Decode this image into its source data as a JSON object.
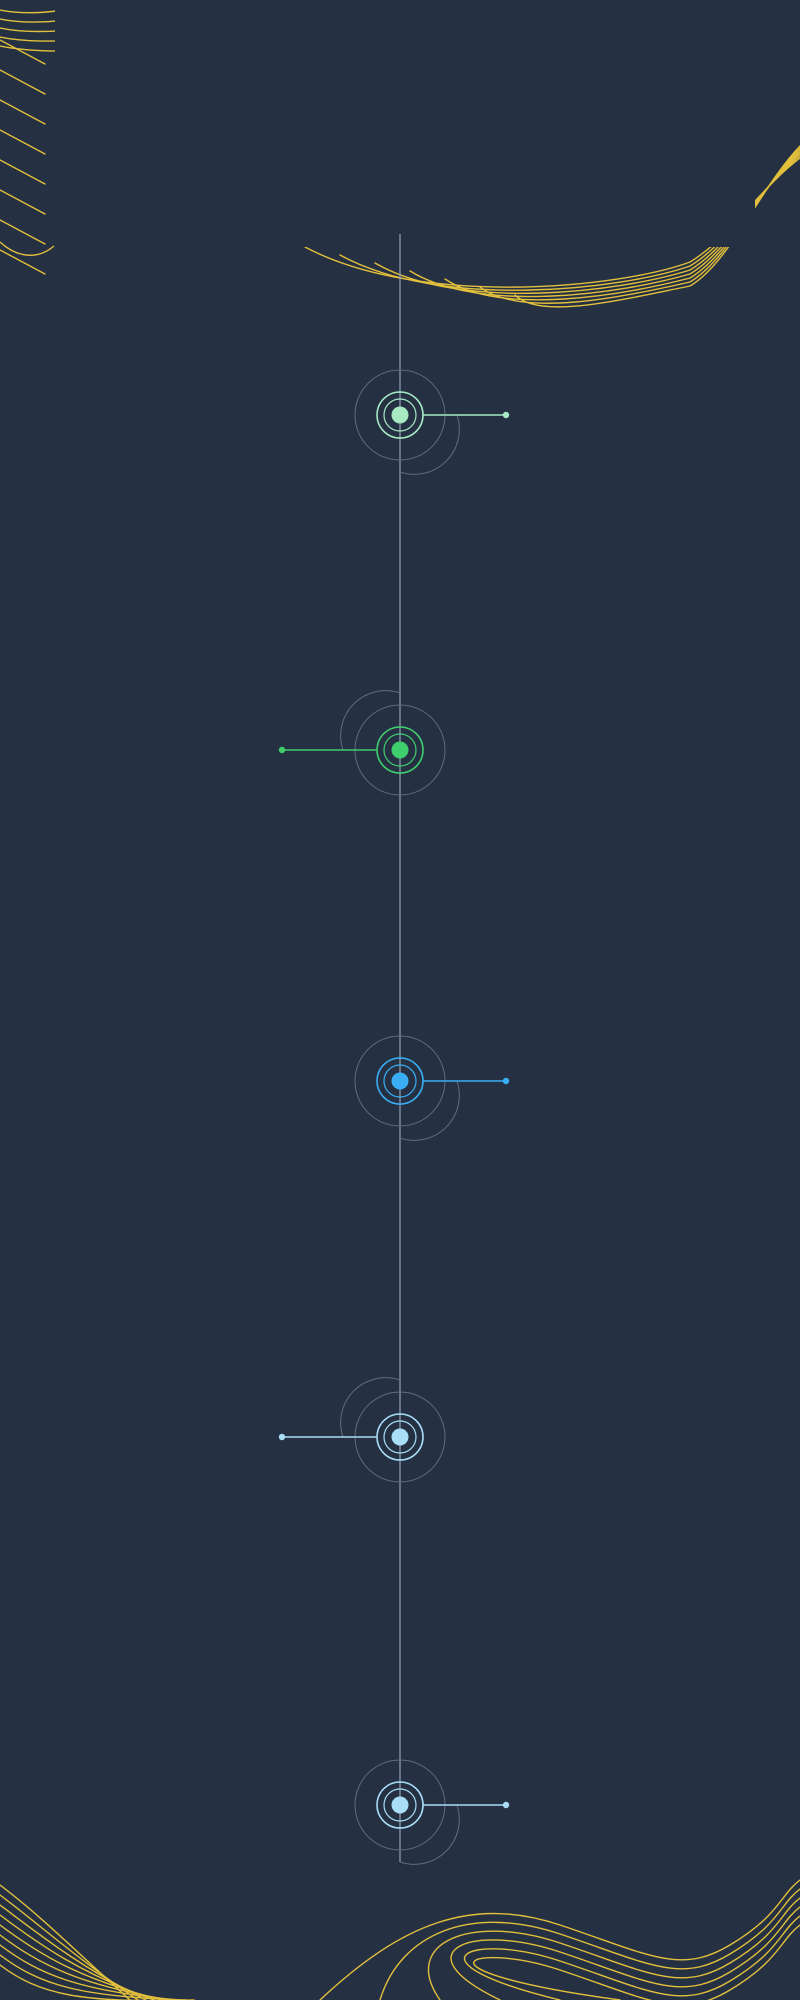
{
  "title": "",
  "colors": {
    "background": "#253142",
    "axis": "#8c9aae",
    "ring": "#5e6c80",
    "decor": "#e2bf3c"
  },
  "timeline": {
    "nodes": [
      {
        "side": "right",
        "color": "#a6e9c3",
        "label": ""
      },
      {
        "side": "left",
        "color": "#3fcd6e",
        "label": ""
      },
      {
        "side": "right",
        "color": "#3aaef4",
        "label": ""
      },
      {
        "side": "left",
        "color": "#a8ddf7",
        "label": ""
      },
      {
        "side": "right",
        "color": "#a8ddf7",
        "label": ""
      }
    ]
  }
}
